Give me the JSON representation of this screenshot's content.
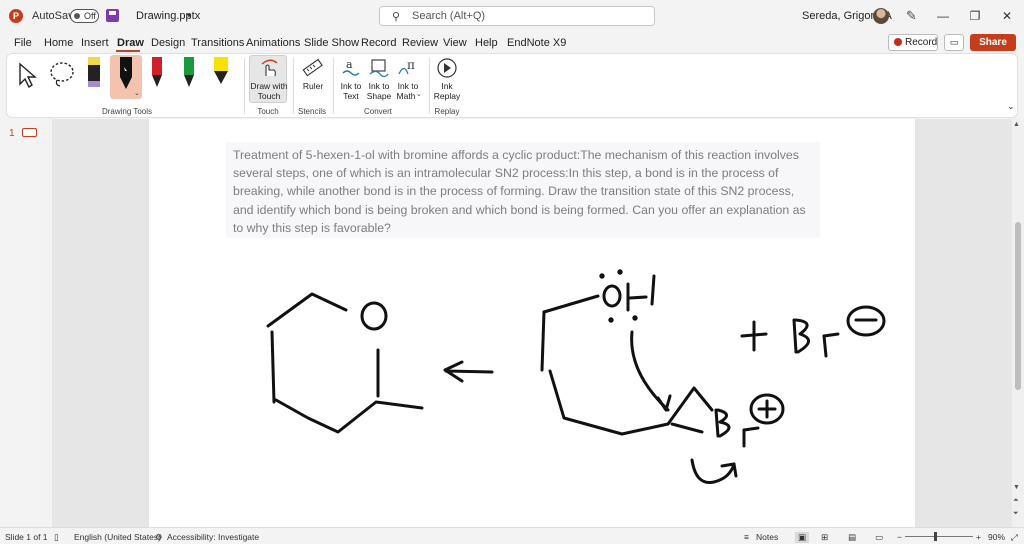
{
  "titlebar": {
    "app_logo": "P",
    "autosave_label": "AutoSave",
    "autosave_state": "Off",
    "filename": "Drawing.pptx",
    "search_placeholder": "Search (Alt+Q)",
    "user_name": "Sereda, Grigoriy A",
    "icons": [
      "powerpoint-logo-icon",
      "save-icon",
      "search-icon",
      "pen-icon",
      "minimize-icon",
      "restore-icon",
      "close-icon"
    ]
  },
  "menubar": {
    "items": [
      "File",
      "Home",
      "Insert",
      "Draw",
      "Design",
      "Transitions",
      "Animations",
      "Slide Show",
      "Record",
      "Review",
      "View",
      "Help",
      "EndNote X9"
    ],
    "active": "Draw",
    "record_label": "Record",
    "share_label": "Share"
  },
  "ribbon": {
    "groups": {
      "drawing_tools": "Drawing Tools",
      "touch": "Touch",
      "stencils": "Stencils",
      "convert": "Convert",
      "replay": "Replay"
    },
    "buttons": {
      "draw_with_touch_1": "Draw with",
      "draw_with_touch_2": "Touch",
      "ruler": "Ruler",
      "ink_to_text_1": "Ink to",
      "ink_to_text_2": "Text",
      "ink_to_shape_1": "Ink to",
      "ink_to_shape_2": "Shape",
      "ink_to_math_1": "Ink to",
      "ink_to_math_2": "Math",
      "ink_replay_1": "Ink",
      "ink_replay_2": "Replay"
    },
    "pen_colors": [
      "#222222",
      "#111111",
      "#d0202a",
      "#1a9a3c",
      "#f5e200"
    ]
  },
  "slides": {
    "current_number": "1"
  },
  "slide": {
    "question": "Treatment of 5-hexen-1-ol with bromine affords a cyclic product:The mechanism of this reaction involves several steps, one of which is an intramolecular SN2 process:In this step, a bond is in the process of breaking, while another bond is in the process of forming. Draw the transition state of this SN2 process, and identify which bond is being broken and which bond is being formed. Can you offer an explanation as to why this step is favorable?"
  },
  "statusbar": {
    "slide_info": "Slide 1 of 1",
    "language": "English (United States)",
    "accessibility": "Accessibility: Investigate",
    "notes": "Notes",
    "zoom_minus": "−",
    "zoom_plus": "+",
    "zoom_level": "90%"
  }
}
